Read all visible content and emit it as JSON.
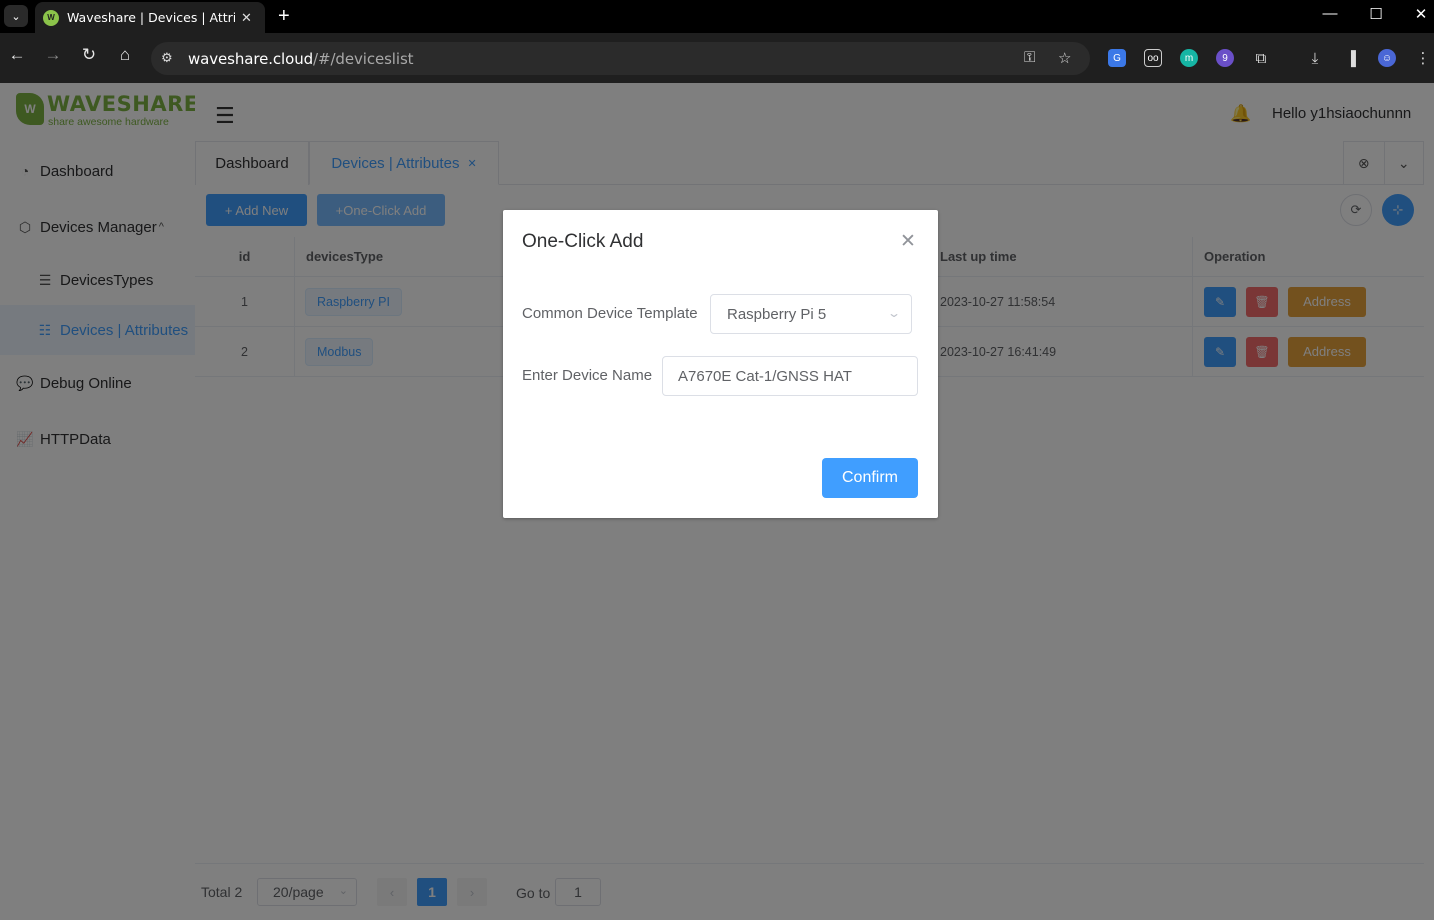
{
  "browser": {
    "tab_title": "Waveshare | Devices | Attributes",
    "favicon_text": "W",
    "url_host": "waveshare.cloud",
    "url_path": "/#/deviceslist"
  },
  "app": {
    "logo": {
      "name": "WAVESHARE",
      "tagline": "share awesome hardware",
      "color": "#7cb342"
    },
    "greeting": "Hello y1hsiaochunnn",
    "sidebar": {
      "dashboard": "Dashboard",
      "devices_manager": "Devices Manager",
      "devices_types": "DevicesTypes",
      "devices_attributes": "Devices | Attributes",
      "debug_online": "Debug Online",
      "http_data": "HTTPData"
    },
    "tabs": {
      "dashboard": "Dashboard",
      "devices": "Devices | Attributes"
    },
    "toolbar": {
      "add_new": "+ Add New",
      "one_click_add": "+One-Click Add"
    },
    "table": {
      "headers": {
        "id": "id",
        "devices_type": "devicesType",
        "last_up_time": "Last up time",
        "operation": "Operation"
      },
      "rows": [
        {
          "id": "1",
          "type": "Raspberry PI",
          "time": "2023-10-27 11:58:54",
          "address": "Address"
        },
        {
          "id": "2",
          "type": "Modbus",
          "time": "2023-10-27 16:41:49",
          "address": "Address"
        }
      ]
    },
    "pager": {
      "total": "Total 2",
      "page_size": "20/page",
      "current_page": "1",
      "goto_label": "Go to",
      "goto_value": "1"
    }
  },
  "modal": {
    "title": "One-Click Add",
    "template_label": "Common Device Template",
    "template_value": "Raspberry Pi 5",
    "name_label": "Enter Device Name",
    "name_value": "A7670E Cat-1/GNSS HAT",
    "confirm": "Confirm"
  },
  "colors": {
    "primary": "#409eff",
    "danger": "#f56c6c",
    "warning": "#e6a23c"
  }
}
